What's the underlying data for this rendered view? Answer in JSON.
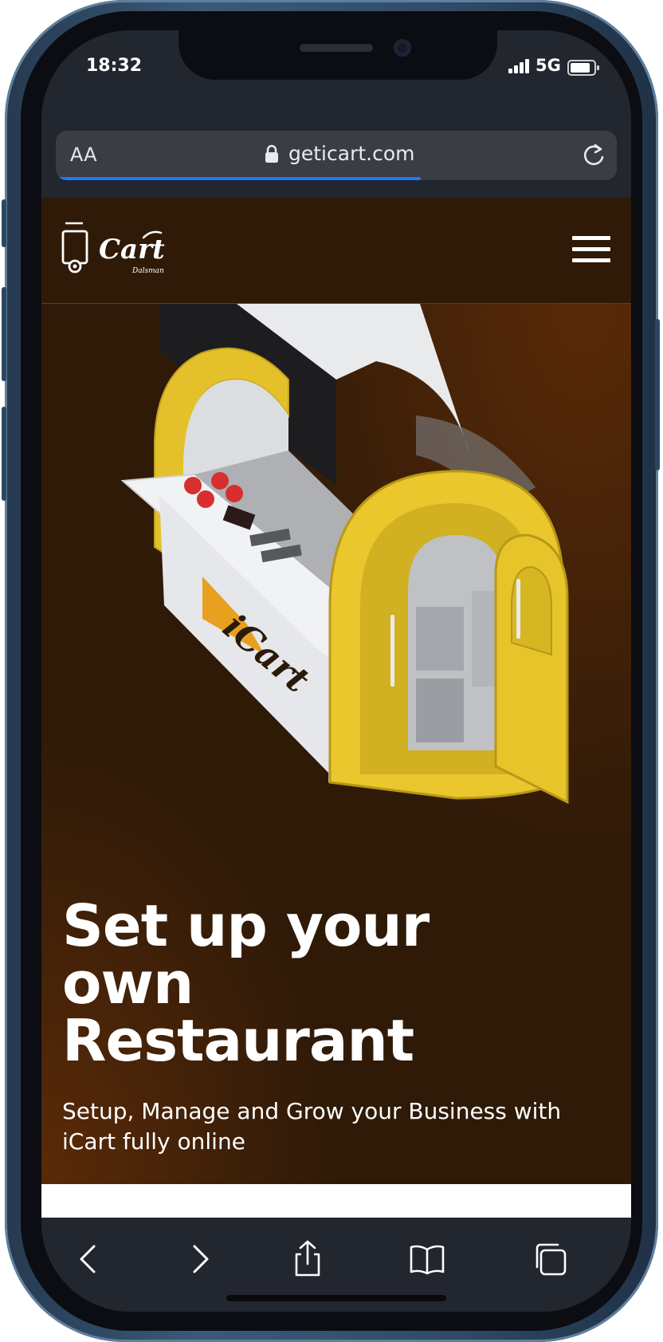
{
  "status_bar": {
    "time": "18:32",
    "network": "5G"
  },
  "address_bar": {
    "text_size_label": "AA",
    "url": "geticart.com",
    "load_progress_percent": 65
  },
  "site_header": {
    "logo_text": "Cart",
    "logo_subtext": "Dalsman",
    "menu_icon": "hamburger-icon"
  },
  "hero": {
    "image": "food-cart-kiosk",
    "kiosk_logo_text": "iCart",
    "headline_lines": [
      "Set up your",
      "own",
      "Restaurant"
    ],
    "subheadline_lines": [
      "Setup, Manage and Grow your Business with",
      "iCart fully online"
    ]
  },
  "toolbar": {
    "icons": [
      "back-icon",
      "forward-icon",
      "share-icon",
      "bookmarks-icon",
      "tabs-icon"
    ]
  },
  "colors": {
    "brand_brown": "#2f1a08",
    "accent_orange": "#5a2a08",
    "kiosk_yellow": "#e8c62a",
    "progress_blue": "#1e7bf2"
  }
}
